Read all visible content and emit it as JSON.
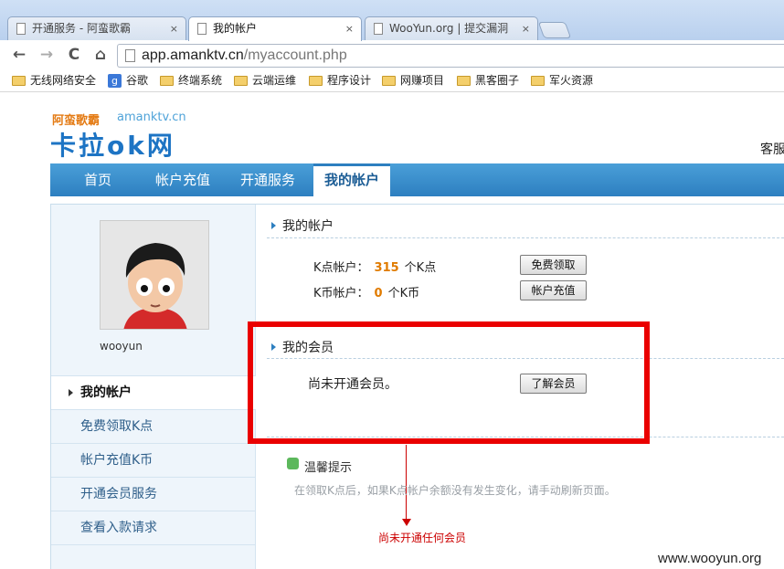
{
  "browser": {
    "tabs": [
      {
        "title": "开通服务 - 阿蛮歌霸",
        "close": "×"
      },
      {
        "title": "我的帐户",
        "close": "×"
      },
      {
        "title": "WooYun.org | 提交漏洞",
        "close": "×"
      }
    ],
    "nav_icons": {
      "back": "←",
      "forward": "→",
      "reload": "C",
      "home": "⌂"
    },
    "url_host": "app.amanktv.cn",
    "url_path": "/myaccount.php",
    "bookmarks": [
      {
        "label": "无线网络安全",
        "icon": "folder-icon"
      },
      {
        "label": "谷歌",
        "icon": "google-icon"
      },
      {
        "label": "终端系统",
        "icon": "folder-icon"
      },
      {
        "label": "云端运维",
        "icon": "folder-icon"
      },
      {
        "label": "程序设计",
        "icon": "folder-icon"
      },
      {
        "label": "网赚项目",
        "icon": "folder-icon"
      },
      {
        "label": "黑客圈子",
        "icon": "folder-icon"
      },
      {
        "label": "军火资源",
        "icon": "folder-icon"
      }
    ]
  },
  "site": {
    "logo_top": "阿蛮歌霸",
    "logo_domain": "amanktv.cn",
    "logo_main": "卡拉ok网",
    "service": "客服",
    "nav": [
      "首页",
      "帐户充值",
      "开通服务",
      "我的帐户"
    ]
  },
  "sidebar": {
    "username": "wooyun",
    "menu": [
      "我的帐户",
      "免费领取K点",
      "帐户充值K币",
      "开通会员服务",
      "查看入款请求"
    ]
  },
  "account": {
    "title": "我的帐户",
    "k_points_label": "K点帐户：",
    "k_points_value": "315",
    "k_points_unit": "个K点",
    "k_points_button": "免费领取",
    "k_coins_label": "K币帐户：",
    "k_coins_value": "0",
    "k_coins_unit": "个K币",
    "k_coins_button": "帐户充值"
  },
  "membership": {
    "title": "我的会员",
    "status": "尚未开通会员。",
    "button": "了解会员"
  },
  "tips": {
    "title": "温馨提示",
    "text": "在领取K点后，如果K点帐户余额没有发生变化，请手动刷新页面。"
  },
  "annotation": "尚未开通任何会员",
  "watermark": "www.wooyun.org",
  "colors": {
    "highlight_box": "#ea0000",
    "nav_blue": "#2d7fc0",
    "points_orange": "#e07b00"
  }
}
